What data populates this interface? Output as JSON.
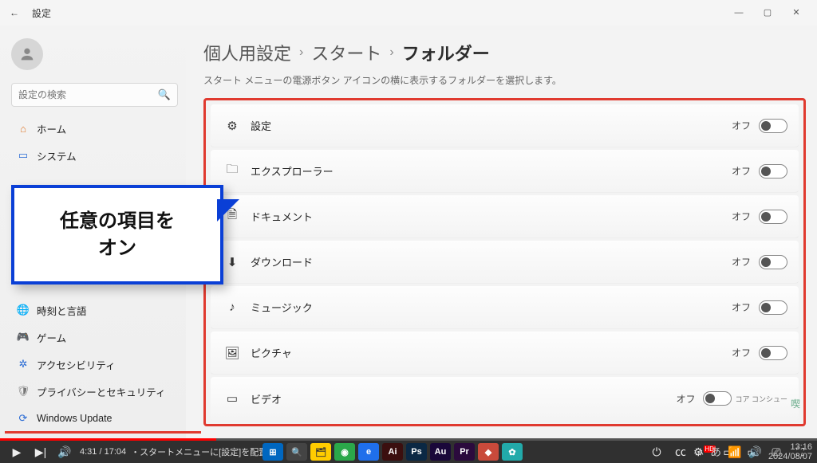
{
  "titlebar": {
    "back": "←",
    "title": "設定"
  },
  "search": {
    "placeholder": "設定の検索"
  },
  "sidebar": {
    "items": [
      {
        "label": "ホーム"
      },
      {
        "label": "システム"
      },
      {
        "label": "時刻と言語"
      },
      {
        "label": "ゲーム"
      },
      {
        "label": "アクセシビリティ"
      },
      {
        "label": "プライバシーとセキュリティ"
      },
      {
        "label": "Windows Update"
      }
    ]
  },
  "breadcrumb": {
    "a": "個人用設定",
    "b": "スタート",
    "c": "フォルダー",
    "sep": "›"
  },
  "subhead": "スタート メニューの電源ボタン アイコンの横に表示するフォルダーを選択します。",
  "rows": [
    {
      "label": "設定",
      "state": "オフ"
    },
    {
      "label": "エクスプローラー",
      "state": "オフ"
    },
    {
      "label": "ドキュメント",
      "state": "オフ"
    },
    {
      "label": "ダウンロード",
      "state": "オフ"
    },
    {
      "label": "ミュージック",
      "state": "オフ"
    },
    {
      "label": "ピクチャ",
      "state": "オフ"
    },
    {
      "label": "ビデオ",
      "state": "オフ"
    }
  ],
  "callout": "任意の項目を\nオン",
  "video": {
    "time": "4:31 / 17:04",
    "chapter": "・スタートメニューに[設定]を配置 ›"
  },
  "clock": {
    "time": "13:16",
    "date": "2024/08/07"
  }
}
